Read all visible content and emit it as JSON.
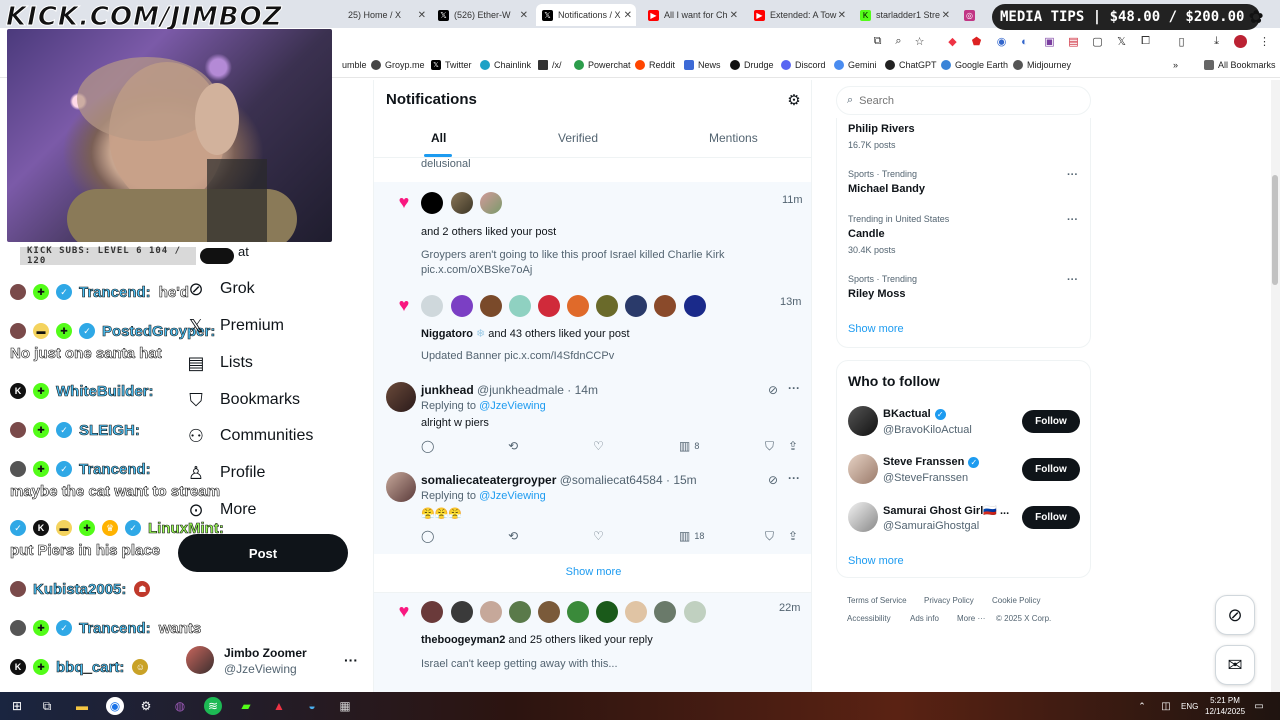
{
  "browser": {
    "tabs": [
      {
        "title": "25) Home / X",
        "icon": "x-logo-icon",
        "active": false
      },
      {
        "title": "(526) Ether-W",
        "icon": "x-logo-icon",
        "active": false
      },
      {
        "title": "Notifications / X",
        "icon": "x-logo-icon",
        "active": true
      },
      {
        "title": "All I want for Ch",
        "icon": "youtube-icon",
        "active": false
      },
      {
        "title": "Extended: A Tow",
        "icon": "youtube-icon",
        "active": false
      },
      {
        "title": "starladder1 Stre",
        "icon": "kick-icon",
        "active": false
      }
    ],
    "bookmarks": [
      "umble",
      "Groyp.me",
      "Twitter",
      "Chainlink",
      "/x/",
      "Powerchat",
      "Reddit",
      "News",
      "Drudge",
      "Discord",
      "Gemini",
      "ChatGPT",
      "Google Earth",
      "Midjourney"
    ],
    "all_bookmarks": "All Bookmarks",
    "accent": "#1d9bf0"
  },
  "overlay": {
    "stream_url": "KICK.COM/JIMBOZ",
    "media_tips": "MEDIA TIPS | $48.00 / $200.00",
    "kick_subs": "KICK SUBS: LEVEL 6 104 / 120",
    "chat": [
      {
        "name": "Trancend:",
        "msg": "he'd",
        "color": "#4fc3f7"
      },
      {
        "name": "PostedGroyper:",
        "msg": "",
        "color": "#4fc3f7"
      },
      {
        "name": "",
        "msg": "No just one santa hat",
        "color": ""
      },
      {
        "name": "WhiteBuilder:",
        "msg": "",
        "color": "#4fc3f7"
      },
      {
        "name": "SLEIGH:",
        "msg": "",
        "color": "#4fc3f7"
      },
      {
        "name": "Trancend:",
        "msg": "",
        "color": "#4fc3f7"
      },
      {
        "name": "",
        "msg": "maybe the cat want to stream",
        "color": ""
      },
      {
        "name": "LinuxMint:",
        "msg": "",
        "color": "#9cff57"
      },
      {
        "name": "",
        "msg": "put Piers in his place",
        "color": ""
      },
      {
        "name": "Kubista2005:",
        "msg": "",
        "color": "#4fc3f7"
      },
      {
        "name": "Trancend:",
        "msg": "wants",
        "color": "#4fc3f7"
      },
      {
        "name": "bbq_cart:",
        "msg": "",
        "color": "#4fc3f7"
      }
    ]
  },
  "nav": {
    "partial_label": "at",
    "items": [
      {
        "label": "Grok",
        "icon": "grok-icon"
      },
      {
        "label": "Premium",
        "icon": "x-logo-icon"
      },
      {
        "label": "Lists",
        "icon": "list-icon"
      },
      {
        "label": "Bookmarks",
        "icon": "bookmark-icon"
      },
      {
        "label": "Communities",
        "icon": "communities-icon"
      },
      {
        "label": "Profile",
        "icon": "profile-icon"
      },
      {
        "label": "More",
        "icon": "more-circle-icon"
      }
    ],
    "post_label": "Post",
    "account": {
      "name": "Jimbo Zoomer",
      "handle": "@JzeViewing"
    }
  },
  "notifications": {
    "title": "Notifications",
    "tabs": [
      "All",
      "Verified",
      "Mentions"
    ],
    "partial_top": "delusional",
    "items": [
      {
        "time": "11m",
        "text_name": "",
        "text_rest": "and 2 others liked your post",
        "sub1": "Groypers aren't going to like this proof Israel killed Charlie Kirk",
        "sub2": "pic.x.com/oXBSke7oAj"
      },
      {
        "time": "13m",
        "text_name": "Niggatoro",
        "text_rest": "and 43 others liked your post",
        "sub1": "Updated Banner pic.x.com/I4SfdnCCPv",
        "sub2": ""
      },
      {
        "time": "22m",
        "text_name": "theboogeyman2",
        "text_rest": "and 25 others liked your reply",
        "sub1": "Israel can't keep getting away with this...",
        "sub2": ""
      }
    ],
    "replies": [
      {
        "name": "junkhead",
        "handle": "@junkheadmale · 14m",
        "replying": "Replying to",
        "to": "@JzeViewing",
        "body": "alright w piers",
        "views": "8"
      },
      {
        "name": "somaliecateatergroyper",
        "handle": "@somaliecat64584 · 15m",
        "replying": "Replying to",
        "to": "@JzeViewing",
        "body": "😤😤😤",
        "views": "18"
      }
    ],
    "show_more": "Show more"
  },
  "right": {
    "search_placeholder": "Search",
    "trends": [
      {
        "context": "",
        "name": "Philip Rivers",
        "posts": "16.7K posts"
      },
      {
        "context": "Sports · Trending",
        "name": "Michael Bandy",
        "posts": ""
      },
      {
        "context": "Trending in United States",
        "name": "Candle",
        "posts": "30.4K posts"
      },
      {
        "context": "Sports · Trending",
        "name": "Riley Moss",
        "posts": ""
      }
    ],
    "trends_show_more": "Show more",
    "who_to_follow": "Who to follow",
    "follow": [
      {
        "name": "BKactual",
        "handle": "@BravoKiloActual",
        "verified": true
      },
      {
        "name": "Steve Franssen",
        "handle": "@SteveFranssen",
        "verified": true
      },
      {
        "name": "Samurai Ghost Girl🇷🇺 ...",
        "handle": "@SamuraiGhostgal",
        "verified": false
      }
    ],
    "follow_label": "Follow",
    "wtf_show_more": "Show more",
    "footer": [
      "Terms of Service",
      "Privacy Policy",
      "Cookie Policy",
      "Accessibility",
      "Ads info",
      "More ···",
      "© 2025 X Corp."
    ]
  },
  "taskbar": {
    "lang": "ENG",
    "time": "5:21 PM",
    "date": "12/14/2025"
  }
}
